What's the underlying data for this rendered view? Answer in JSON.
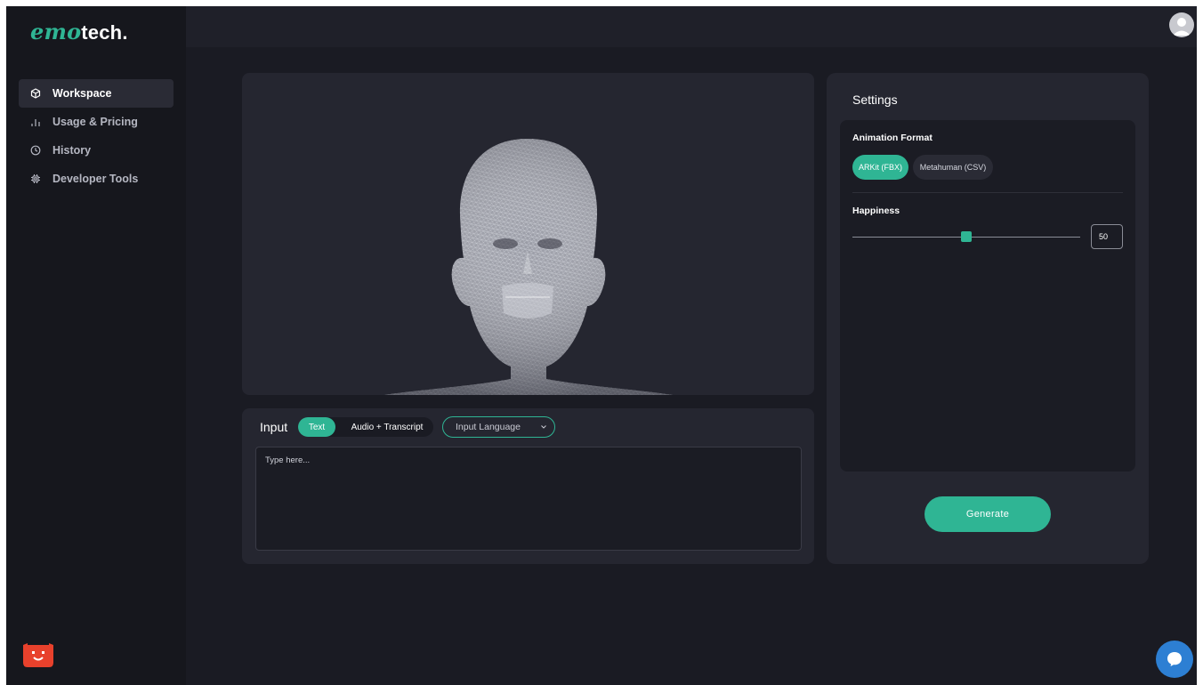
{
  "brand": {
    "script": "emo",
    "rest": "tech",
    "dot": "."
  },
  "nav": {
    "items": [
      {
        "label": "Workspace",
        "icon": "cube-icon",
        "active": true
      },
      {
        "label": "Usage & Pricing",
        "icon": "bar-chart-icon",
        "active": false
      },
      {
        "label": "History",
        "icon": "clock-icon",
        "active": false
      },
      {
        "label": "Developer Tools",
        "icon": "chip-icon",
        "active": false
      }
    ]
  },
  "input": {
    "title": "Input",
    "modes": [
      {
        "label": "Text",
        "active": true
      },
      {
        "label": "Audio + Transcript",
        "active": false
      }
    ],
    "language_select": {
      "value": "Input Language"
    },
    "textarea": {
      "placeholder": "Type here..."
    }
  },
  "settings": {
    "title": "Settings",
    "animation_format": {
      "label": "Animation Format",
      "options": [
        {
          "label": "ARKit (FBX)",
          "active": true
        },
        {
          "label": "Metahuman (CSV)",
          "active": false
        }
      ]
    },
    "happiness": {
      "label": "Happiness",
      "value": 50,
      "min": 0,
      "max": 100
    },
    "generate_label": "Generate"
  },
  "colors": {
    "accent": "#2fb594",
    "background": "#1a1b23",
    "panel": "#252630",
    "chat": "#2d7fd3",
    "bug": "#e8412c"
  }
}
